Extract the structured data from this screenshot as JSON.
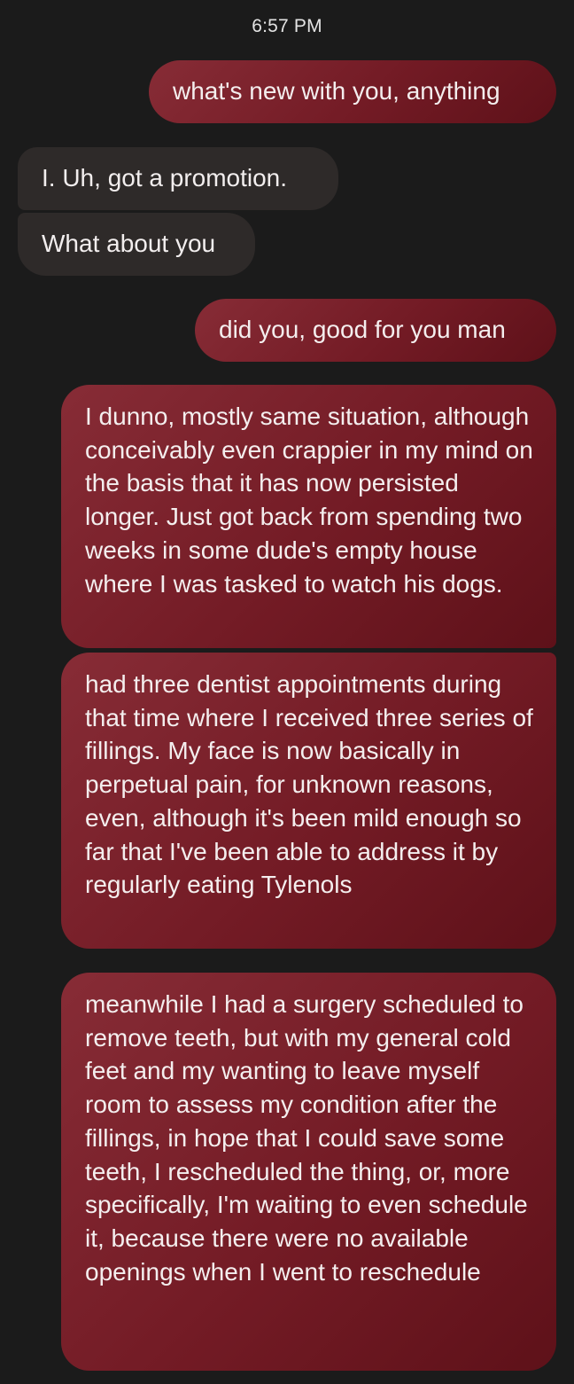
{
  "status": {
    "timestamp": "6:57 PM"
  },
  "messages": [
    {
      "direction": "sent",
      "text": "what's new with you, anything"
    },
    {
      "direction": "received",
      "text": "I. Uh, got a promotion."
    },
    {
      "direction": "received",
      "text": "What about you"
    },
    {
      "direction": "sent",
      "text": "did you, good for you man"
    },
    {
      "direction": "sent",
      "text": "I dunno, mostly same situation, although conceivably even crappier in my mind on the basis that it has now persisted longer. Just got back from spending two weeks in some dude's empty house where I was tasked to watch his dogs."
    },
    {
      "direction": "sent",
      "text": "had three dentist appointments during that time where I received three series of fillings. My face is now basically in perpetual pain, for unknown reasons, even, although it's been mild enough so far that I've been able to address it by regularly eating Tylenols"
    },
    {
      "direction": "sent",
      "text": "meanwhile I had a surgery scheduled to remove teeth, but with my general cold feet and my wanting to leave myself room to assess my condition after the fillings, in hope that I could save some teeth, I rescheduled the thing, or, more specifically, I'm waiting to even schedule it, because there were no available openings when I went to reschedule"
    }
  ],
  "colors": {
    "background": "#1b1b1b",
    "sent_bubble": "#7a1f2a",
    "received_bubble": "#2e2a29",
    "text": "#f4eeee"
  }
}
